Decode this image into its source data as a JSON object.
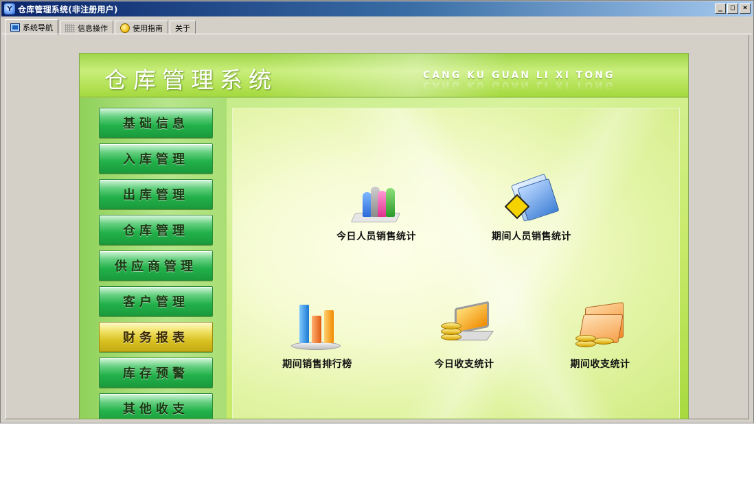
{
  "window": {
    "title": "仓库管理系统(非注册用户)",
    "app_icon": "yc-app-icon",
    "controls": {
      "minimize": "_",
      "restore": "□",
      "close": "×"
    }
  },
  "tabs": [
    {
      "label": "系统导航",
      "icon": "monitor-icon",
      "active": true
    },
    {
      "label": "信息操作",
      "icon": "grid-icon",
      "active": false
    },
    {
      "label": "使用指南",
      "icon": "guide-icon",
      "active": false
    },
    {
      "label": "关于",
      "icon": "",
      "active": false
    }
  ],
  "banner": {
    "title": "仓库管理系统",
    "subtitle": "CANG KU GUAN LI XI TONG"
  },
  "sidebar": {
    "items": [
      {
        "label": "基础信息",
        "active": false
      },
      {
        "label": "入库管理",
        "active": false
      },
      {
        "label": "出库管理",
        "active": false
      },
      {
        "label": "仓库管理",
        "active": false
      },
      {
        "label": "供应商管理",
        "active": false
      },
      {
        "label": "客户管理",
        "active": false
      },
      {
        "label": "财务报表",
        "active": true
      },
      {
        "label": "库存预警",
        "active": false
      },
      {
        "label": "其他收支",
        "active": false
      }
    ]
  },
  "content": {
    "tiles": [
      {
        "label": "今日人员销售统计",
        "icon": "people-icon"
      },
      {
        "label": "期间人员销售统计",
        "icon": "folder-people-icon"
      },
      {
        "label": "期间销售排行榜",
        "icon": "bar-chart-icon"
      },
      {
        "label": "今日收支统计",
        "icon": "laptop-coins-icon"
      },
      {
        "label": "期间收支统计",
        "icon": "folder-coins-icon"
      }
    ]
  },
  "colors": {
    "titlebar_start": "#0a246a",
    "nav_green": "#22b14a",
    "nav_active_gold": "#d9c222",
    "banner_green": "#a4d93d"
  }
}
